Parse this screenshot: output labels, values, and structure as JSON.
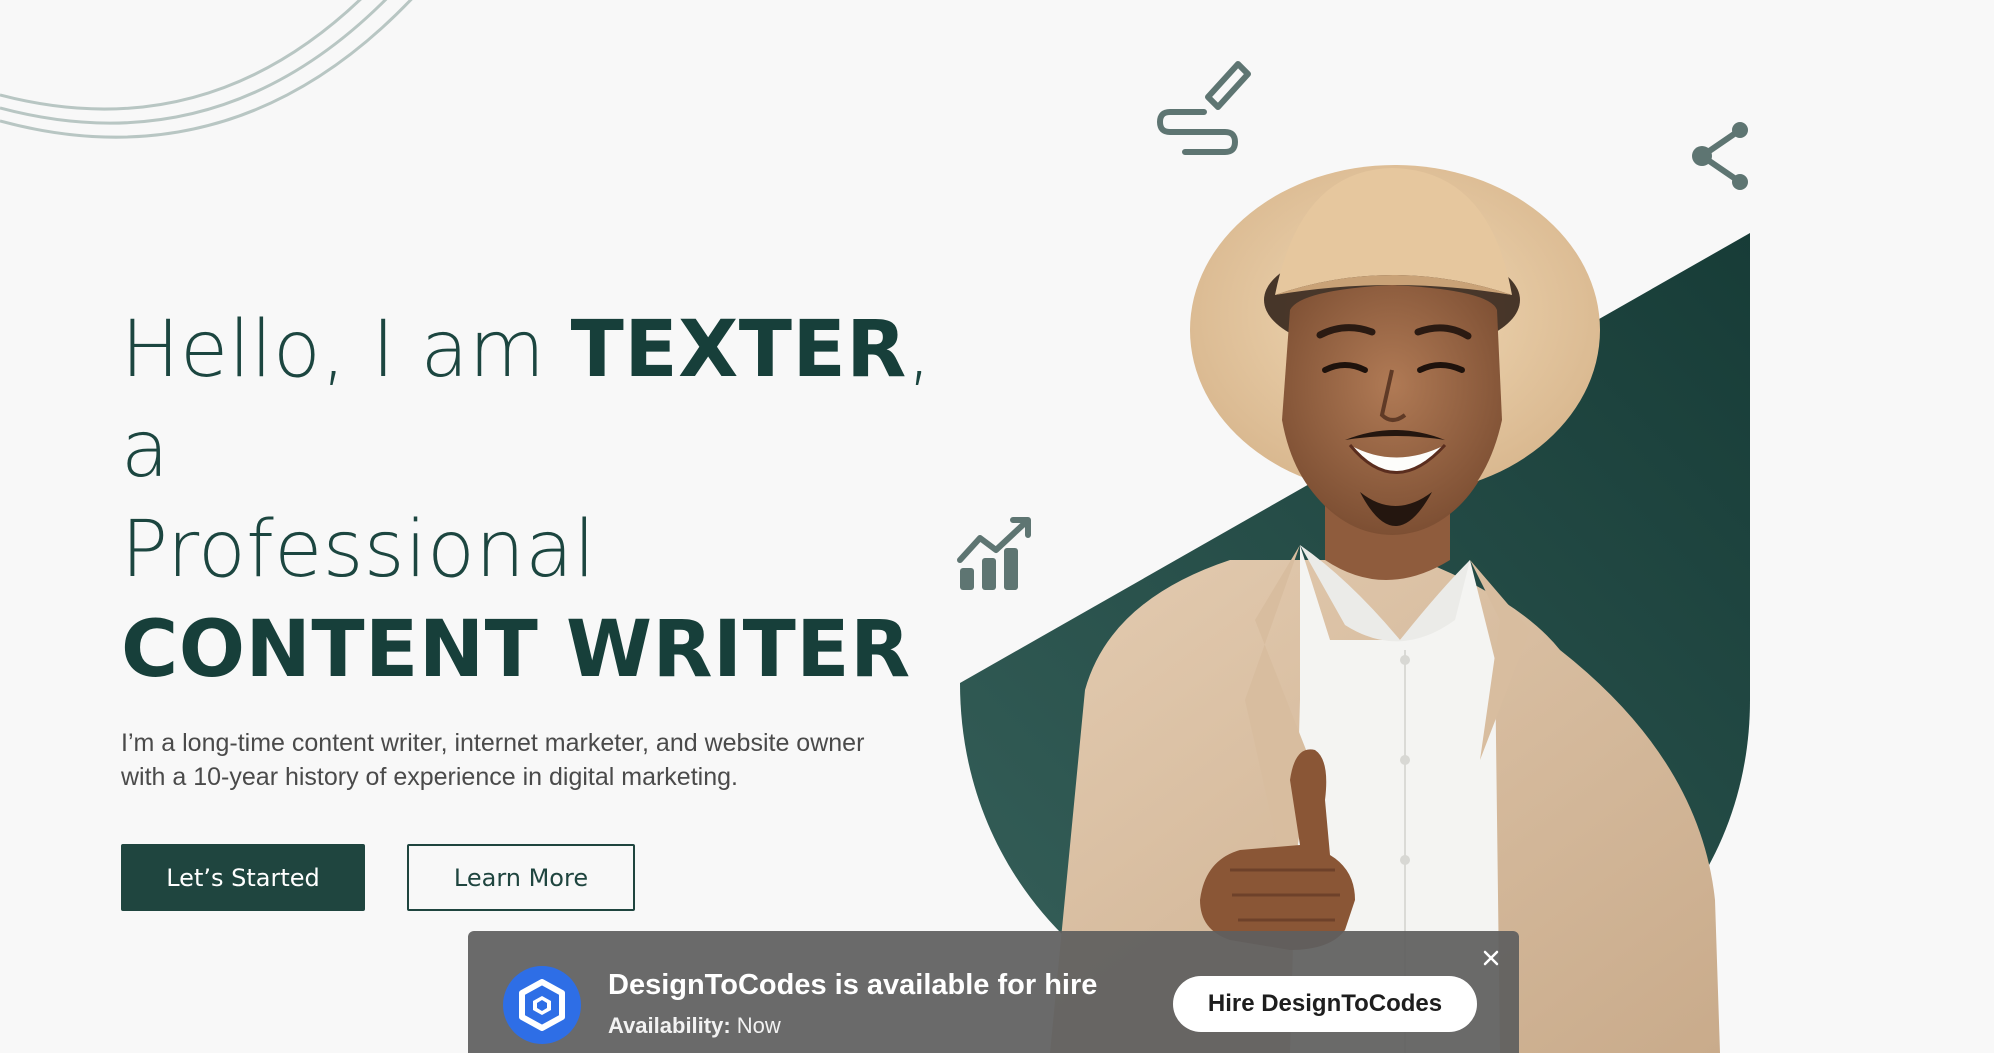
{
  "hero": {
    "headline_intro": "Hello, I am ",
    "name": "TEXTER",
    "headline_suffix": ", a",
    "headline_line2": "Professional",
    "headline_line3": "CONTENT WRITER",
    "description": "I’m a long-time content writer, internet marketer, and website owner with a 10-year history of experience in digital marketing.",
    "primary_button": "Let’s Started",
    "secondary_button": "Learn More"
  },
  "icons": {
    "pen": "pen-signature-icon",
    "chart": "growth-chart-icon",
    "share": "share-icon"
  },
  "hire_banner": {
    "title": "DesignToCodes is available for hire",
    "availability_label": "Availability:",
    "availability_value": "Now",
    "button": "Hire DesignToCodes",
    "close": "×"
  },
  "colors": {
    "primary": "#1f453f",
    "background": "#f8f8f8",
    "hire_logo": "#2e6ee6"
  }
}
